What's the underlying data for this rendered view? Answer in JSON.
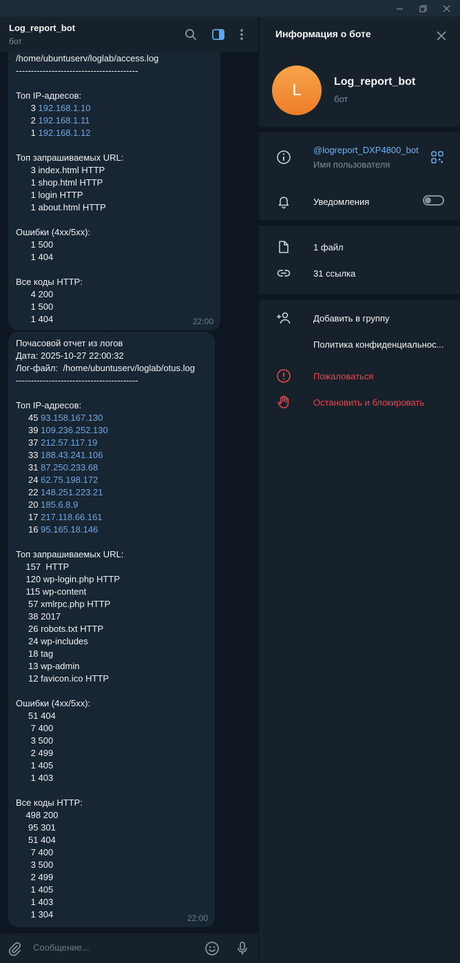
{
  "chat": {
    "title": "Log_report_bot",
    "subtitle": "бот",
    "composer_placeholder": "Сообщение...",
    "messages": [
      {
        "time": "22:00",
        "lines": [
          [
            {
              "t": "/home/ubuntuserv/loglab/access.log"
            }
          ],
          [
            {
              "t": "-----------------------------------------"
            }
          ],
          [],
          [
            {
              "t": "Топ IP-адресов:"
            }
          ],
          [
            {
              "t": "      3 "
            },
            {
              "t": "192.168.1.10",
              "link": true
            }
          ],
          [
            {
              "t": "      2 "
            },
            {
              "t": "192.168.1.11",
              "link": true
            }
          ],
          [
            {
              "t": "      1 "
            },
            {
              "t": "192.168.1.12",
              "link": true
            }
          ],
          [],
          [
            {
              "t": "Топ запрашиваемых URL:"
            }
          ],
          [
            {
              "t": "      3 index.html HTTP"
            }
          ],
          [
            {
              "t": "      1 shop.html HTTP"
            }
          ],
          [
            {
              "t": "      1 login HTTP"
            }
          ],
          [
            {
              "t": "      1 about.html HTTP"
            }
          ],
          [],
          [
            {
              "t": "Ошибки (4xx/5xx):"
            }
          ],
          [
            {
              "t": "      1 500"
            }
          ],
          [
            {
              "t": "      1 404"
            }
          ],
          [],
          [
            {
              "t": "Все коды HTTP:"
            }
          ],
          [
            {
              "t": "      4 200"
            }
          ],
          [
            {
              "t": "      1 500"
            }
          ],
          [
            {
              "t": "      1 404"
            }
          ]
        ]
      },
      {
        "time": "22:00",
        "lines": [
          [
            {
              "t": "Почасовой отчет из логов"
            }
          ],
          [
            {
              "t": "Дата: 2025-10-27 22:00:32"
            }
          ],
          [
            {
              "t": "Лог-файл:  /home/ubuntuserv/loglab/otus.log"
            }
          ],
          [
            {
              "t": "-----------------------------------------"
            }
          ],
          [],
          [
            {
              "t": "Топ IP-адресов:"
            }
          ],
          [
            {
              "t": "     45 "
            },
            {
              "t": "93.158.167.130",
              "link": true
            }
          ],
          [
            {
              "t": "     39 "
            },
            {
              "t": "109.236.252.130",
              "link": true
            }
          ],
          [
            {
              "t": "     37 "
            },
            {
              "t": "212.57.117.19",
              "link": true
            }
          ],
          [
            {
              "t": "     33 "
            },
            {
              "t": "188.43.241.106",
              "link": true
            }
          ],
          [
            {
              "t": "     31 "
            },
            {
              "t": "87.250.233.68",
              "link": true
            }
          ],
          [
            {
              "t": "     24 "
            },
            {
              "t": "62.75.198.172",
              "link": true
            }
          ],
          [
            {
              "t": "     22 "
            },
            {
              "t": "148.251.223.21",
              "link": true
            }
          ],
          [
            {
              "t": "     20 "
            },
            {
              "t": "185.6.8.9",
              "link": true
            }
          ],
          [
            {
              "t": "     17 "
            },
            {
              "t": "217.118.66.161",
              "link": true
            }
          ],
          [
            {
              "t": "     16 "
            },
            {
              "t": "95.165.18.146",
              "link": true
            }
          ],
          [],
          [
            {
              "t": "Топ запрашиваемых URL:"
            }
          ],
          [
            {
              "t": "    157  HTTP"
            }
          ],
          [
            {
              "t": "    120 wp-login.php HTTP"
            }
          ],
          [
            {
              "t": "    115 wp-content"
            }
          ],
          [
            {
              "t": "     57 xmlrpc.php HTTP"
            }
          ],
          [
            {
              "t": "     38 2017"
            }
          ],
          [
            {
              "t": "     26 robots.txt HTTP"
            }
          ],
          [
            {
              "t": "     24 wp-includes"
            }
          ],
          [
            {
              "t": "     18 tag"
            }
          ],
          [
            {
              "t": "     13 wp-admin"
            }
          ],
          [
            {
              "t": "     12 favicon.ico HTTP"
            }
          ],
          [],
          [
            {
              "t": "Ошибки (4xx/5xx):"
            }
          ],
          [
            {
              "t": "     51 404"
            }
          ],
          [
            {
              "t": "      7 400"
            }
          ],
          [
            {
              "t": "      3 500"
            }
          ],
          [
            {
              "t": "      2 499"
            }
          ],
          [
            {
              "t": "      1 405"
            }
          ],
          [
            {
              "t": "      1 403"
            }
          ],
          [],
          [
            {
              "t": "Все коды HTTP:"
            }
          ],
          [
            {
              "t": "    498 200"
            }
          ],
          [
            {
              "t": "     95 301"
            }
          ],
          [
            {
              "t": "     51 404"
            }
          ],
          [
            {
              "t": "      7 400"
            }
          ],
          [
            {
              "t": "      3 500"
            }
          ],
          [
            {
              "t": "      2 499"
            }
          ],
          [
            {
              "t": "      1 405"
            }
          ],
          [
            {
              "t": "      1 403"
            }
          ],
          [
            {
              "t": "      1 304"
            }
          ]
        ]
      }
    ]
  },
  "info": {
    "title": "Информация о боте",
    "avatar_letter": "L",
    "name": "Log_report_bot",
    "type": "бот",
    "username": "@logreport_DXP4800_bot",
    "username_label": "Имя пользователя",
    "notifications_label": "Уведомления",
    "notifications_on": false,
    "files": "1 файл",
    "links": "31 ссылка",
    "add_to_group": "Добавить в группу",
    "privacy": "Политика конфиденциальнос...",
    "report": "Пожаловаться",
    "block": "Остановить и блокировать"
  },
  "colors": {
    "background": "#0e1621",
    "panel": "#17212b",
    "bubble": "#182533",
    "link": "#71a7e0",
    "accent": "#6ab2f2",
    "danger": "#e5484d",
    "avatar": "#f0892f"
  },
  "icons": [
    "minimize-icon",
    "restore-icon",
    "close-window-icon",
    "search-icon",
    "sidebar-toggle-icon",
    "more-vertical-icon",
    "paperclip-icon",
    "emoji-icon",
    "microphone-icon",
    "close-icon",
    "info-icon",
    "qr-code-icon",
    "bell-icon",
    "file-icon",
    "link-icon",
    "add-user-icon",
    "report-icon",
    "hand-stop-icon"
  ]
}
